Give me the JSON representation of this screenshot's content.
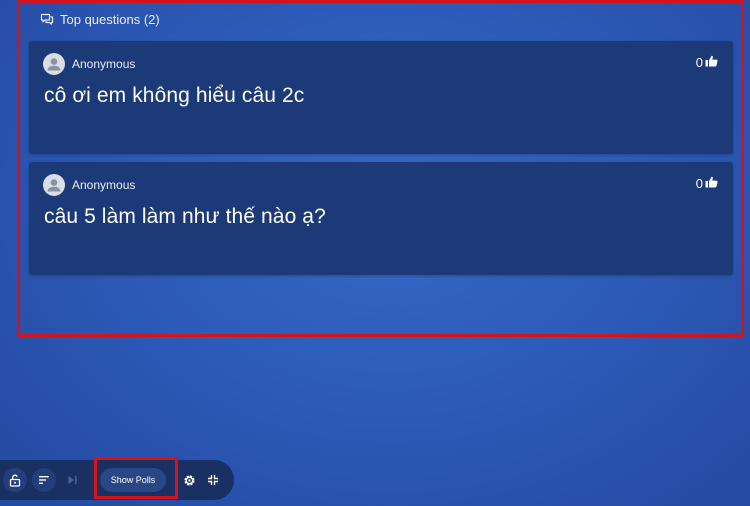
{
  "panel": {
    "title": "Top questions (2)",
    "icon": "chat-bubbles-icon"
  },
  "questions": [
    {
      "author": "Anonymous",
      "likes": "0",
      "text": "cô ơi em không hiểu câu 2c"
    },
    {
      "author": "Anonymous",
      "likes": "0",
      "text": "câu 5 làm làm như thế nào ạ?"
    }
  ],
  "toolbar": {
    "show_polls_label": "Show Polls",
    "icons": [
      "unlock-icon",
      "sort-icon",
      "skip-next-icon",
      "gear-icon",
      "collapse-icon"
    ]
  },
  "colors": {
    "background": "#2d5bb9",
    "card": "#1c3a78",
    "toolbar": "#1a2f62",
    "highlight": "#d4141c"
  }
}
